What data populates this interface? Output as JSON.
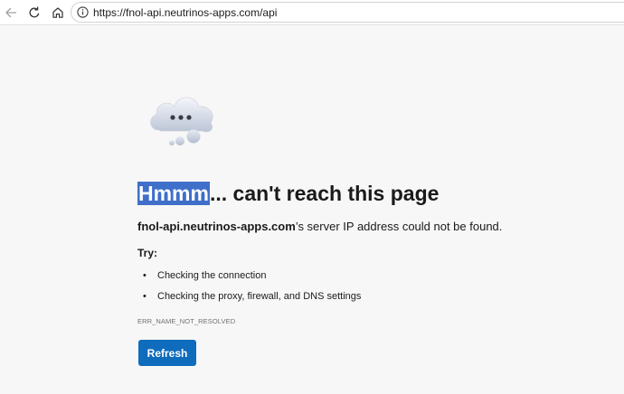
{
  "browser": {
    "url": "https://fnol-api.neutrinos-apps.com/api"
  },
  "error_page": {
    "heading_highlight": "Hmmm",
    "heading_rest": "... can't reach this page",
    "description_host": "fnol-api.neutrinos-apps.com",
    "description_rest": "’s server IP address could not be found.",
    "try_label": "Try:",
    "tips": [
      {
        "bullet": "•",
        "text": "Checking the connection"
      },
      {
        "bullet": "•",
        "text": "Checking the proxy, firewall, and DNS settings"
      }
    ],
    "error_code": "ERR_NAME_NOT_RESOLVED",
    "refresh_label": "Refresh"
  },
  "colors": {
    "accent": "#0f6cbd",
    "highlight": "#3f6fc9",
    "page_background": "#f7f7f7"
  },
  "icons": {
    "back": "arrow-left-icon",
    "reload": "reload-icon",
    "home": "home-icon",
    "site_info": "info-icon",
    "error_illustration": "cloud-icon"
  }
}
